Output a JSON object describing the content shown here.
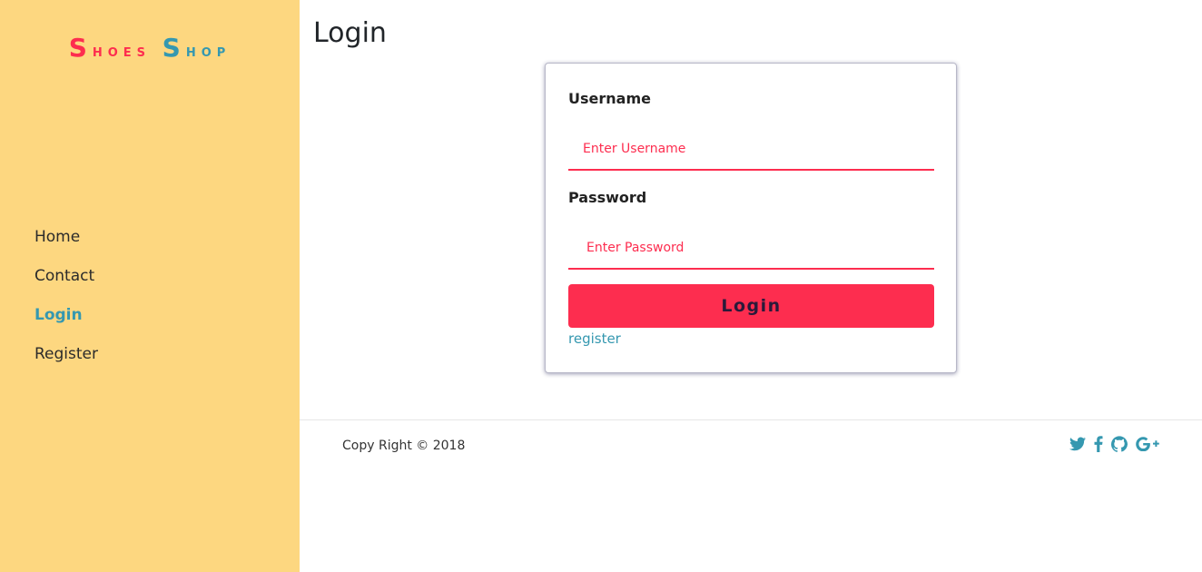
{
  "sidebar": {
    "brand": {
      "word1_cap": "S",
      "word1_rest": "hoes",
      "word2_cap": "S",
      "word2_rest": "hop"
    },
    "nav": [
      {
        "label": "Home",
        "active": false
      },
      {
        "label": "Contact",
        "active": false
      },
      {
        "label": "Login",
        "active": true
      },
      {
        "label": "Register",
        "active": false
      }
    ]
  },
  "main": {
    "title": "Login",
    "form": {
      "username_label": "Username",
      "username_placeholder": "Enter Username",
      "password_label": "Password",
      "password_placeholder": "Enter Password",
      "submit_label": "Login",
      "register_link": "register"
    }
  },
  "footer": {
    "copyright": "Copy Right © 2018",
    "social": [
      "twitter-icon",
      "facebook-icon",
      "github-icon",
      "google-plus-icon"
    ]
  },
  "colors": {
    "sidebar_bg": "#fdd780",
    "accent_red": "#fd2d4f",
    "accent_teal": "#3598b0"
  }
}
